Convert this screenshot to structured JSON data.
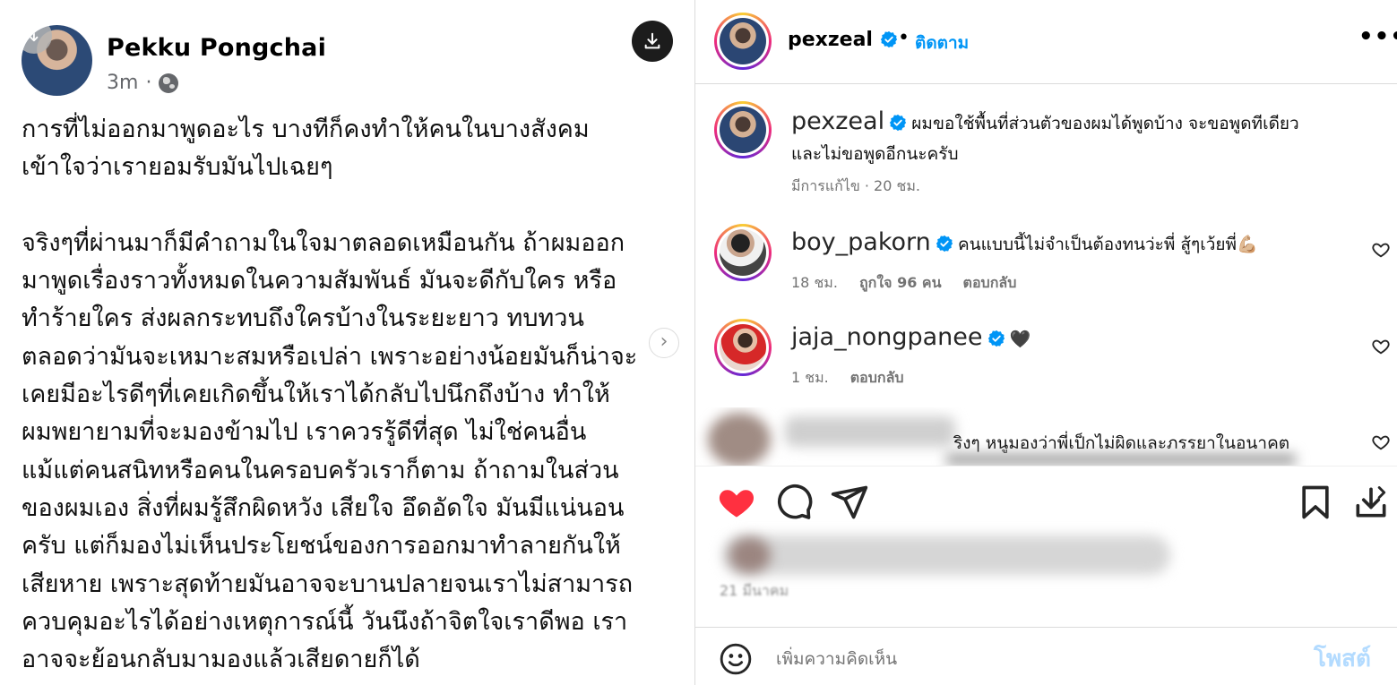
{
  "left_post": {
    "author_name": "Pekku Pongchai",
    "time_ago": "3m",
    "meta_separator": "·",
    "download_icon": "download-icon",
    "next_icon": "chevron-right-icon",
    "globe_icon": "globe-icon",
    "body": "การที่ไม่ออกมาพูดอะไร บางทีก็คงทำให้คนในบางสังคม\nเข้าใจว่าเรายอมรับมันไปเฉยๆ\n\nจริงๆที่ผ่านมาก็มีคำถามในใจมาตลอดเหมือนกัน ถ้าผมออก\nมาพูดเรื่องราวทั้งหมดในความสัมพันธ์ มันจะดีกับใคร หรือ\nทำร้ายใคร ส่งผลกระทบถึงใครบ้างในระยะยาว ทบทวน\nตลอดว่ามันจะเหมาะสมหรือเปล่า เพราะอย่างน้อยมันก็น่าจะ\nเคยมีอะไรดีๆที่เคยเกิดขึ้นให้เราได้กลับไปนึกถึงบ้าง ทำให้\nผมพยายามที่จะมองข้ามไป เราควรรู้ดีที่สุด ไม่ใช่คนอื่น\nแม้แต่คนสนิทหรือคนในครอบครัวเราก็ตาม ถ้าถามในส่วน\nของผมเอง สิ่งที่ผมรู้สึกผิดหวัง เสียใจ อึดอัดใจ มันมีแน่นอน\nครับ แต่ก็มองไม่เห็นประโยชน์ของการออกมาทำลายกันให้\nเสียหาย เพราะสุดท้ายมันอาจจะบานปลายจนเราไม่สามารถ\nควบคุมอะไรได้อย่างเหตุการณ์นี้ วันนึงถ้าจิตใจเราดีพอ เรา\nอาจจะย้อนกลับมามองแล้วเสียดายก็ได้"
  },
  "header": {
    "username": "pexzeal",
    "dot": "•",
    "follow_label": "ติดตาม",
    "more_icon": "more-options-icon",
    "more_glyph": "•••"
  },
  "caption": {
    "username": "pexzeal",
    "text_line1": "ผมขอใช้พื้นที่ส่วนตัวของผมได้พูดบ้าง จะขอพูดทีเดียว",
    "text_line2": "และไม่ขอพูดอีกนะครับ",
    "meta": "มีการแก้ไข · 20 ชม."
  },
  "comments": [
    {
      "username": "boy_pakorn",
      "text": "คนแบบนี้ไม่จำเป็นต้องทนว่ะพี่ สู้ๆเว้ยพี่💪🏼",
      "time": "18 ชม.",
      "likes": "ถูกใจ 96 คน",
      "reply": "ตอบกลับ"
    },
    {
      "username": "jaja_nongpanee",
      "text": "🖤",
      "time": "1 ชม.",
      "reply": "ตอบกลับ"
    },
    {
      "username": "",
      "text_line1": "ริงๆ หนูมองว่าพี่เป็กไม่ผิดและภรรยาในอนาคต"
    }
  ],
  "likes_meta": "21 มีนาคม",
  "add_comment": {
    "placeholder": "เพิ่มความคิดเห็น",
    "post_label": "โพสต์",
    "emoji_icon": "emoji-icon"
  },
  "colors": {
    "accent_blue": "#0095f6",
    "post_disabled": "#b3dbff",
    "like_red": "#ff3040",
    "muted": "#737373"
  }
}
